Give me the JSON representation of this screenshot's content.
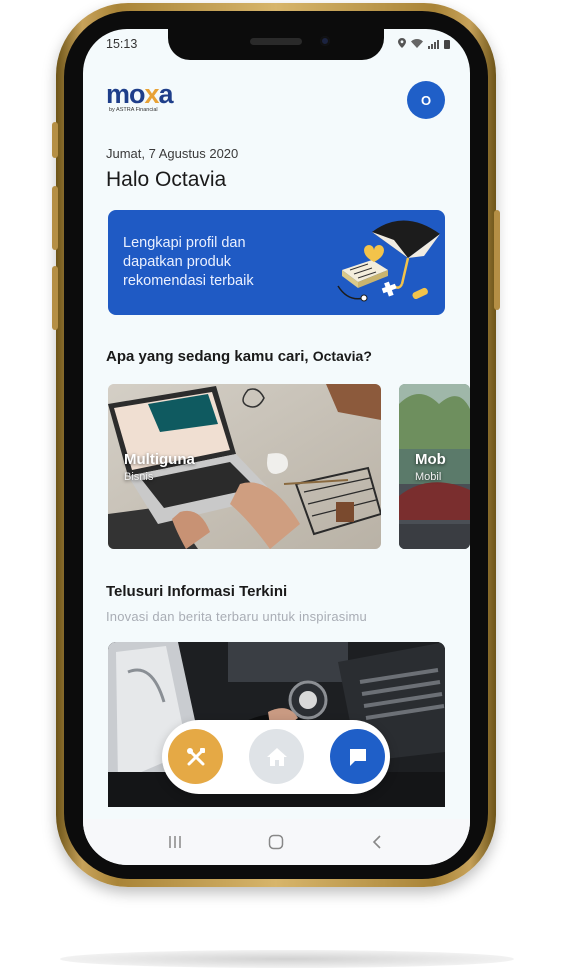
{
  "status_bar": {
    "time": "15:13"
  },
  "header": {
    "logo_word_1": "mo",
    "logo_word_2": "x",
    "logo_word_3": "a",
    "logo_sub": "by ASTRA Financial",
    "avatar_initial": "O"
  },
  "greeting": {
    "date": "Jumat, 7 Agustus 2020",
    "hello": "Halo Octavia"
  },
  "banner": {
    "text": "Lengkapi profil dan dapatkan produk rekomendasi terbaik"
  },
  "search_section": {
    "title": "Apa yang sedang kamu cari,",
    "user": "Octavia?"
  },
  "categories": [
    {
      "title": "Multiguna",
      "subtitle": "Bisnis"
    },
    {
      "title": "Mob",
      "subtitle": "Mobil"
    }
  ],
  "news_section": {
    "title": "Telusuri Informasi Terkini",
    "subtitle": "Inovasi dan berita terbaru untuk inspirasimu"
  },
  "colors": {
    "primary": "#1f5fc8",
    "accent": "#e5a945",
    "background": "#f4fafc",
    "frame_gold": "#c7a25a"
  },
  "fab_icons": [
    "tools-icon",
    "home-icon",
    "chat-icon"
  ],
  "nav_icons": [
    "recents-icon",
    "home-circle-icon",
    "back-icon"
  ]
}
